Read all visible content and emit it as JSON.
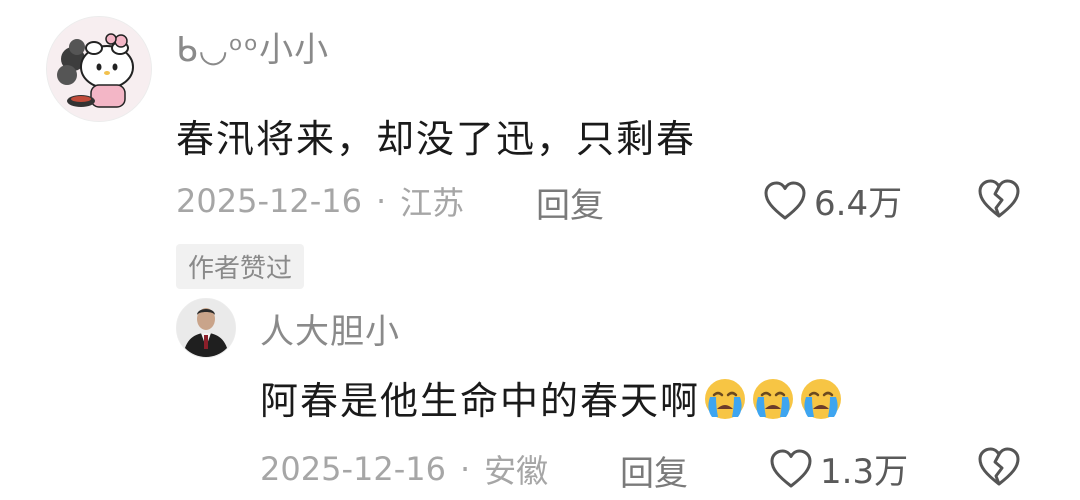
{
  "comment": {
    "username": "ᑲ◡ᵒᵒ小小",
    "text": "春汛将来，却没了迅，只剩春",
    "date": "2025-12-16",
    "location": "江苏",
    "dot": "·",
    "reply_label": "回复",
    "likes": "6.4万",
    "author_badge": "作者赞过"
  },
  "reply_comment": {
    "username": "人大胆小",
    "text": "阿春是他生命中的春天啊",
    "emoji_count": 3,
    "date": "2025-12-16",
    "location": "安徽",
    "dot": "·",
    "reply_label": "回复",
    "likes": "1.3万"
  },
  "icons": {
    "like": "heart-outline-icon",
    "dislike": "broken-heart-icon",
    "emoji": "crying-face-emoji"
  },
  "colors": {
    "text_primary": "#1a1a1a",
    "text_secondary": "#8a8a8a",
    "meta": "#a6a6a6",
    "badge_bg": "#f1f1f1"
  }
}
